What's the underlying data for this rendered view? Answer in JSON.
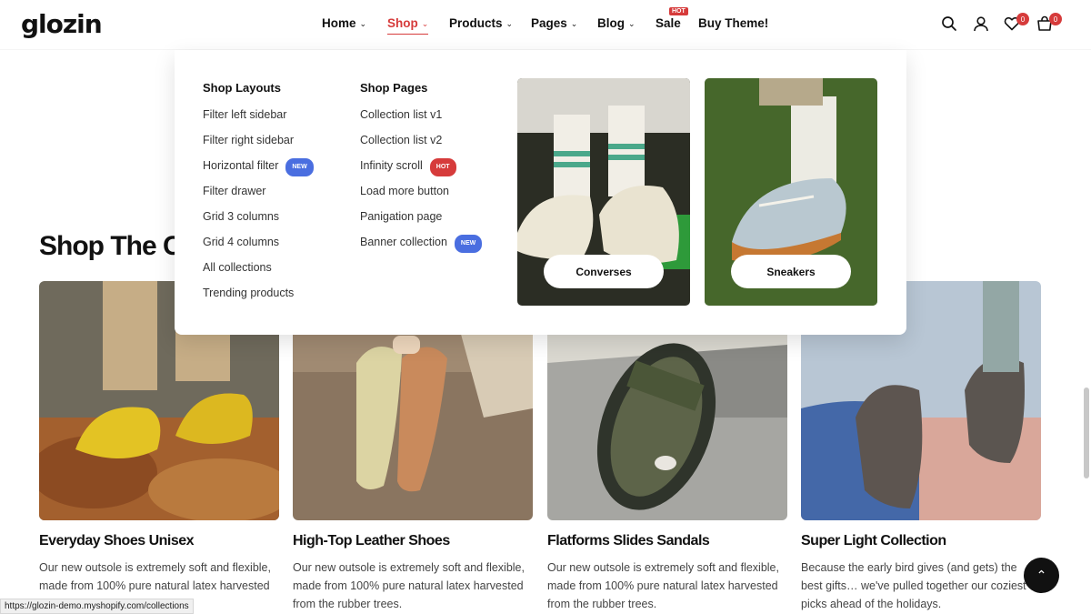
{
  "header": {
    "logo": "glozin",
    "nav": [
      {
        "label": "Home",
        "chevron": true
      },
      {
        "label": "Shop",
        "chevron": true,
        "active": true
      },
      {
        "label": "Products",
        "chevron": true
      },
      {
        "label": "Pages",
        "chevron": true
      },
      {
        "label": "Blog",
        "chevron": true
      },
      {
        "label": "Sale",
        "chevron": false,
        "badge": "HOT"
      },
      {
        "label": "Buy Theme!",
        "chevron": false
      }
    ],
    "icons": [
      "search-icon",
      "user-icon",
      "heart-icon",
      "cart-icon"
    ],
    "wishlist_count": "0",
    "cart_count": "0"
  },
  "mega_menu": {
    "shop_layouts": {
      "heading": "Shop Layouts",
      "links": [
        {
          "label": "Filter left sidebar"
        },
        {
          "label": "Filter right sidebar"
        },
        {
          "label": "Horizontal filter",
          "tag": "NEW"
        },
        {
          "label": "Filter drawer"
        },
        {
          "label": "Grid 3 columns"
        },
        {
          "label": "Grid 4 columns"
        },
        {
          "label": "All collections"
        },
        {
          "label": "Trending products"
        }
      ]
    },
    "shop_pages": {
      "heading": "Shop Pages",
      "links": [
        {
          "label": "Collection list v1"
        },
        {
          "label": "Collection list v2"
        },
        {
          "label": "Infinity scroll",
          "tag": "HOT"
        },
        {
          "label": "Load more button"
        },
        {
          "label": "Panigation page"
        },
        {
          "label": "Banner collection",
          "tag": "NEW"
        }
      ]
    },
    "promos": [
      {
        "label": "Converses"
      },
      {
        "label": "Sneakers"
      }
    ]
  },
  "section": {
    "title": "Shop The Co"
  },
  "cards": [
    {
      "title": "Everyday Shoes Unisex",
      "desc": "Our new outsole is extremely soft and flexible, made from 100% pure natural latex harvested from the rubber trees."
    },
    {
      "title": "High-Top Leather Shoes",
      "desc": "Our new outsole is extremely soft and flexible, made from 100% pure natural latex harvested from the rubber trees."
    },
    {
      "title": "Flatforms Slides Sandals",
      "desc": "Our new outsole is extremely soft and flexible, made from 100% pure natural latex harvested from the rubber trees."
    },
    {
      "title": "Super Light Collection",
      "desc": "Because the early bird gives (and gets) the best gifts… we've pulled together our coziest picks ahead of the holidays."
    }
  ],
  "status_url": "https://glozin-demo.myshopify.com/collections",
  "colors": {
    "accent": "#d63b3b",
    "new_tag": "#4a6ee0"
  }
}
